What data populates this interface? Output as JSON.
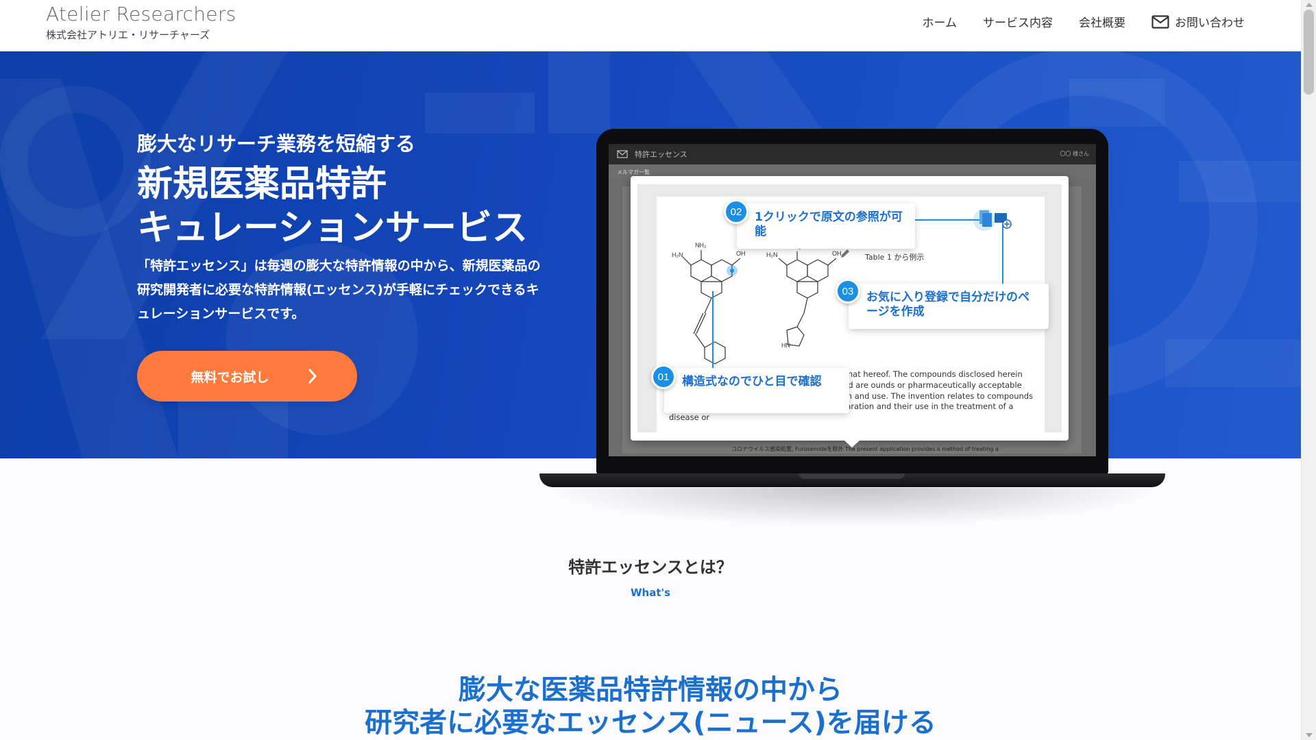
{
  "header": {
    "brand_en": "Atelier Researchers",
    "brand_ja": "株式会社アトリエ・リサーチャーズ",
    "nav": [
      "ホーム",
      "サービス内容",
      "会社概要",
      "お問い合わせ"
    ],
    "contact_icon": "mail-icon"
  },
  "hero": {
    "subtitle": "膨大なリサーチ業務を短縮する",
    "title_line1": "新規医薬品特許",
    "title_line2": "キュレーションサービス",
    "description": "「特許エッセンス」は毎週の膨大な特許情報の中から、新規医薬品の研究開発者に必要な特許情報(エッセンス)が手軽にチェックできるキュレーションサービスです。",
    "cta_label": "無料でお試し",
    "colors": {
      "hero_bg": "#1446b9",
      "cta": "#ff7a3c",
      "accent": "#1a8fe3"
    }
  },
  "mockup": {
    "app_title": "特許エッセンス",
    "app_user": "〇〇 様さん",
    "list_label": "メルマガ一覧",
    "table_ref": "Table 1 から例示",
    "doc_text": "d pharmaceutically acceptable salts thereof that hereof. The compounds disclosed herein may be nhibitory kinase (Myt1). Also disclosed are ounds or pharmaceutically acceptable salts thereof and methods of their preparation and use. The invention relates to compounds and pharmaceutical compositions, their preparation and their use in the treatment of a disease or",
    "behind_text": "コロナウイルス感染処置, Furosemideを除外 The present application provides a method of treating a",
    "callouts": [
      {
        "num": "01",
        "text": "構造式なのでひと目で確認"
      },
      {
        "num": "02",
        "text": "1クリックで原文の参照が可能"
      },
      {
        "num": "03",
        "text": "お気に入り登録で自分だけのページを作成"
      }
    ]
  },
  "whats": {
    "title": "特許エッセンスとは？",
    "subtitle": "What's",
    "lead_line1": "膨大な医薬品特許情報の中から",
    "lead_line2": "研究者に必要なエッセンス(ニュース)を届ける"
  }
}
